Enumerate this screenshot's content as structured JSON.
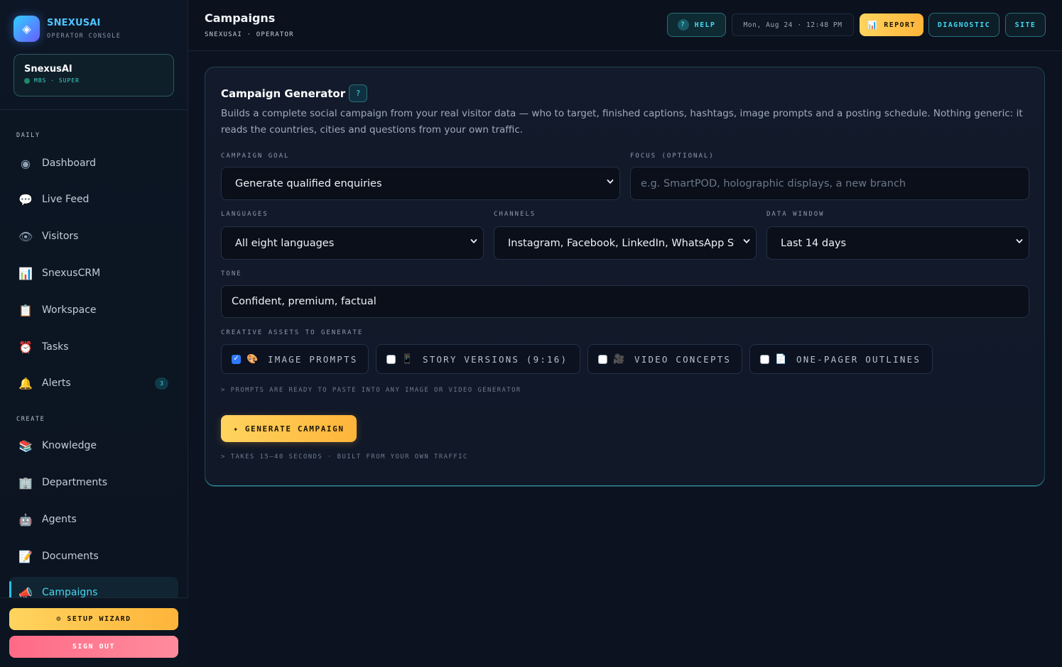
{
  "brand": {
    "logo_glyph": "◈",
    "name": "SNEXUSAI",
    "subtitle": "OPERATOR CONSOLE"
  },
  "org": {
    "name": "SnexusAI",
    "meta": "MBS · SUPER"
  },
  "sidebar": {
    "sections": [
      {
        "label": "DAILY"
      },
      {
        "label": "CREATE"
      }
    ],
    "items": [
      {
        "icon": "◉",
        "icon_name": "dashboard-icon",
        "label": "Dashboard"
      },
      {
        "icon": "💬",
        "icon_name": "chat-bubble-icon",
        "label": "Live Feed"
      },
      {
        "icon": "👁",
        "icon_name": "eye-icon",
        "label": "Visitors"
      },
      {
        "icon": "📊",
        "icon_name": "bar-chart-icon",
        "label": "SnexusCRM"
      },
      {
        "icon": "📋",
        "icon_name": "clipboard-icon",
        "label": "Workspace"
      },
      {
        "icon": "⏰",
        "icon_name": "alarm-clock-icon",
        "label": "Tasks"
      },
      {
        "icon": "🔔",
        "icon_name": "bell-icon",
        "label": "Alerts",
        "badge": "3"
      },
      {
        "icon": "📚",
        "icon_name": "books-icon",
        "label": "Knowledge"
      },
      {
        "icon": "🏢",
        "icon_name": "building-icon",
        "label": "Departments"
      },
      {
        "icon": "🤖",
        "icon_name": "robot-icon",
        "label": "Agents"
      },
      {
        "icon": "📝",
        "icon_name": "memo-icon",
        "label": "Documents"
      },
      {
        "icon": "📣",
        "icon_name": "megaphone-icon",
        "label": "Campaigns",
        "active": true
      }
    ],
    "setup_label": "⚙ SETUP WIZARD",
    "signout_label": "SIGN OUT"
  },
  "header": {
    "title": "Campaigns",
    "breadcrumb": "SNEXUSAI · OPERATOR",
    "help_icon": "?",
    "help_label": "HELP",
    "clock": "Mon, Aug 24 · 12:48 PM",
    "report_icon": "📊",
    "report_label": "REPORT",
    "diagnostic_label": "DIAGNOSTIC",
    "site_label": "SITE"
  },
  "generator": {
    "title": "Campaign Generator",
    "help_icon": "?",
    "description": "Builds a complete social campaign from your real visitor data — who to target, finished captions, hashtags, image prompts and a posting schedule. Nothing generic: it reads the countries, cities and questions from your own traffic.",
    "goal": {
      "label": "CAMPAIGN GOAL",
      "value": "Generate qualified enquiries"
    },
    "focus": {
      "label": "FOCUS (OPTIONAL)",
      "placeholder": "e.g. SmartPOD, holographic displays, a new branch",
      "value": ""
    },
    "languages": {
      "label": "LANGUAGES",
      "value": "All eight languages"
    },
    "channels": {
      "label": "CHANNELS",
      "value": "Instagram, Facebook, LinkedIn, WhatsApp Stat"
    },
    "window": {
      "label": "DATA WINDOW",
      "value": "Last 14 days"
    },
    "tone": {
      "label": "TONE",
      "value": "Confident, premium, factual"
    },
    "assets_label": "CREATIVE ASSETS TO GENERATE",
    "assets": [
      {
        "icon": "🎨",
        "icon_name": "palette-icon",
        "label": "IMAGE PROMPTS",
        "checked": true
      },
      {
        "icon": "📱",
        "icon_name": "mobile-phone-icon",
        "label": "STORY VERSIONS (9:16)",
        "checked": false
      },
      {
        "icon": "🎥",
        "icon_name": "video-camera-icon",
        "label": "VIDEO CONCEPTS",
        "checked": false
      },
      {
        "icon": "📄",
        "icon_name": "document-icon",
        "label": "ONE-PAGER OUTLINES",
        "checked": false
      }
    ],
    "assets_hint": "> PROMPTS ARE READY TO PASTE INTO ANY IMAGE OR VIDEO GENERATOR",
    "generate_label": "✦ GENERATE CAMPAIGN",
    "generate_hint": "> TAKES 15–40 SECONDS · BUILT FROM YOUR OWN TRAFFIC"
  },
  "colors": {
    "accent": "#45d6f0",
    "brand": "#4ec3ff",
    "primary_button": "#ffc24a",
    "danger_button": "#ff7890",
    "background": "#0c1220"
  }
}
